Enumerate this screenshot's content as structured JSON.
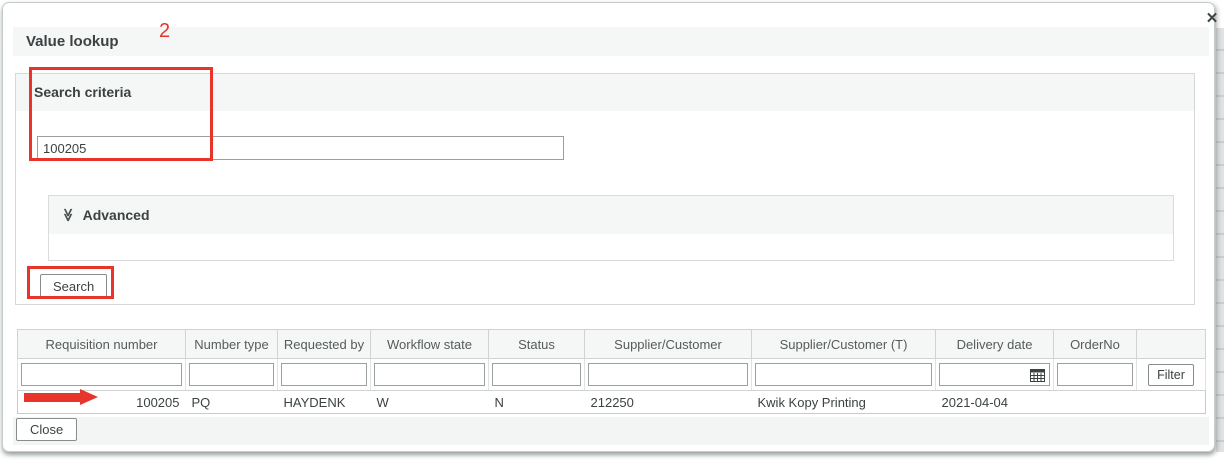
{
  "dialog": {
    "title": "Value lookup",
    "annotation_number": "2",
    "close_icon": "✕"
  },
  "search": {
    "section_title": "Search criteria",
    "input_value": "100205",
    "advanced_chevron": "≫",
    "advanced_label": "Advanced",
    "search_button": "Search"
  },
  "table": {
    "columns": [
      "Requisition number",
      "Number type",
      "Requested by",
      "Workflow state",
      "Status",
      "Supplier/Customer",
      "Supplier/Customer (T)",
      "Delivery date",
      "OrderNo"
    ],
    "filter_button": "Filter",
    "row": {
      "requisition_number": "100205",
      "number_type": "PQ",
      "requested_by": "HAYDENK",
      "workflow_state": "W",
      "status": "N",
      "supplier_customer": "212250",
      "supplier_customer_t": "Kwik Kopy Printing",
      "delivery_date": "2021-04-04",
      "order_no": ""
    }
  },
  "footer": {
    "close_button": "Close"
  },
  "colors": {
    "annotation_red": "#e8352b",
    "strip_gray": "#f5f6f6",
    "border_gray": "#cfd3d3"
  }
}
